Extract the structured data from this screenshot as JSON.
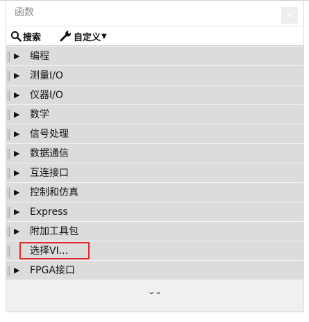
{
  "palette": {
    "title": "函数",
    "close_icon": "close-icon",
    "toolbar": {
      "search_label": "搜索",
      "customize_label": "自定义",
      "dropdown_symbol": "▼"
    },
    "categories": [
      {
        "label": "编程",
        "has_children": true
      },
      {
        "label": "测量I/O",
        "has_children": true
      },
      {
        "label": "仪器I/O",
        "has_children": true
      },
      {
        "label": "数学",
        "has_children": true
      },
      {
        "label": "信号处理",
        "has_children": true
      },
      {
        "label": "数据通信",
        "has_children": true
      },
      {
        "label": "互连接口",
        "has_children": true
      },
      {
        "label": "控制和仿真",
        "has_children": true
      },
      {
        "label": "Express",
        "has_children": true
      },
      {
        "label": "附加工具包",
        "has_children": true
      },
      {
        "label": "选择VI...",
        "has_children": false,
        "highlighted": true,
        "highlight_color": "#e1272b"
      },
      {
        "label": "FPGA接口",
        "has_children": true
      }
    ],
    "expand_symbol": "⌄⌄",
    "arrow_symbol": "▶"
  }
}
